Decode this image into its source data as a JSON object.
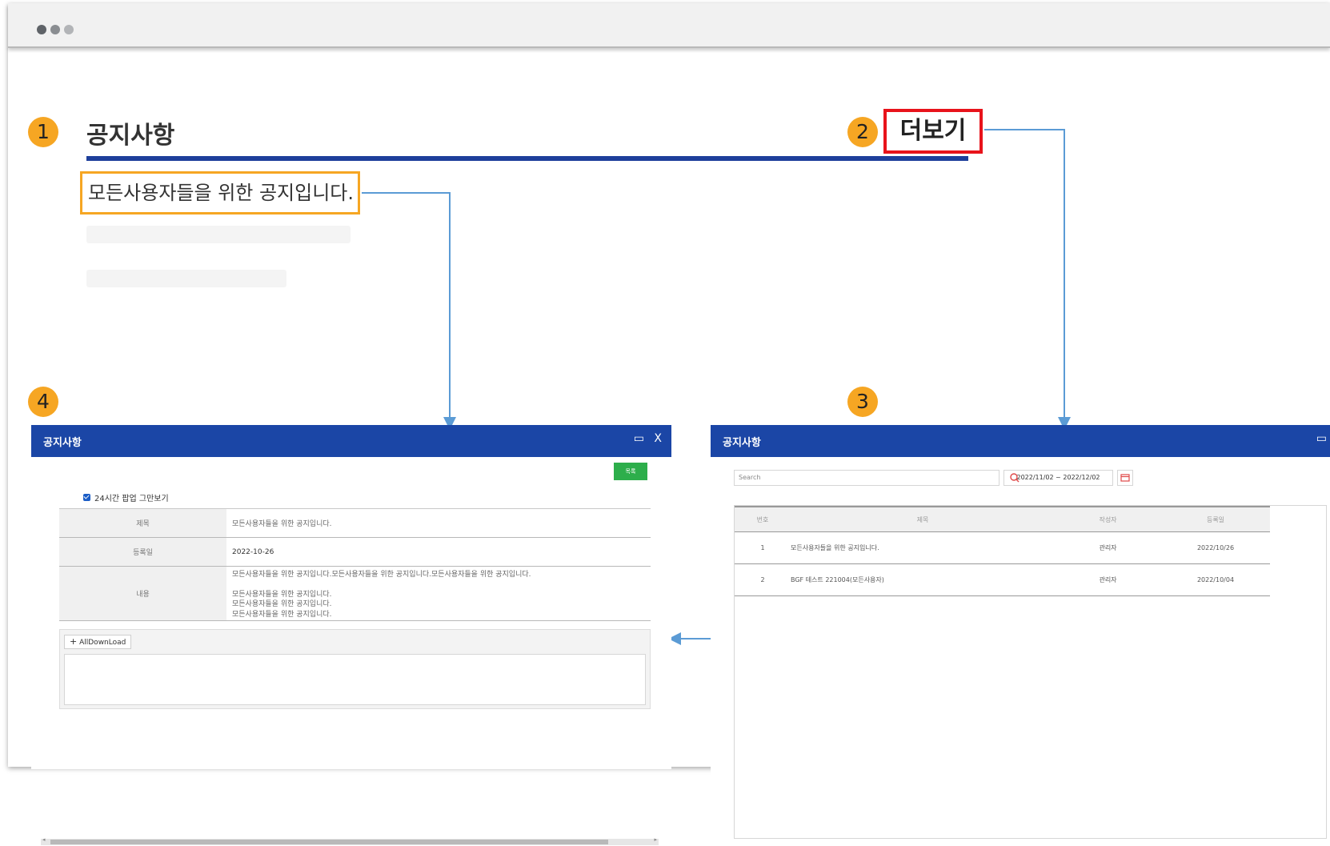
{
  "badges": {
    "b1": "1",
    "b2": "2",
    "b3": "3",
    "b4": "4"
  },
  "notice_widget": {
    "title": "공지사항",
    "more_label": "더보기",
    "items": [
      "모든사용자들을 위한 공지입니다."
    ]
  },
  "popup_detail": {
    "title": "공지사항",
    "list_button": "목록",
    "hide_checkbox_label": "24시간 팝업 그만보기",
    "hide_checkbox_checked": true,
    "rows": {
      "subject_label": "제목",
      "subject_value": "모든사용자들을 위한 공지입니다.",
      "date_label": "등록일",
      "date_value": "2022-10-26",
      "content_label": "내용",
      "content_lines": [
        "모든사용자들을 위한 공지입니다.모든사용자들을 위한 공지입니다.모든사용자들을 위한 공지입니다.",
        "",
        "모든사용자들을 위한 공지입니다.",
        "모든사용자들을 위한 공지입니다.",
        "모든사용자들을 위한 공지입니다."
      ]
    },
    "download_button": "AllDownLoad"
  },
  "popup_list": {
    "title": "공지사항",
    "search_placeholder": "Search",
    "date_range": "2022/11/02 ~ 2022/12/02",
    "columns": [
      "번호",
      "제목",
      "작성자",
      "등록일"
    ],
    "rows": [
      {
        "no": "1",
        "subject": "모든사용자들을 위한 공지입니다.",
        "author": "관리자",
        "date": "2022/10/26"
      },
      {
        "no": "2",
        "subject": "BGF 테스트 221004(모든사용자)",
        "author": "관리자",
        "date": "2022/10/04"
      }
    ]
  },
  "colors": {
    "header_blue": "#1b46a6",
    "badge_orange": "#f6a623",
    "highlight_red": "#e8131b",
    "button_green": "#2dae4b",
    "arrow_blue": "#5b9bd5"
  }
}
